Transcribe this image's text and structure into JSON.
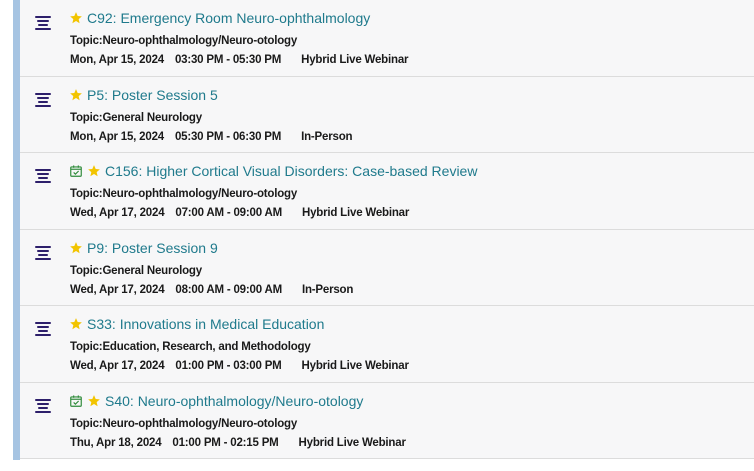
{
  "colors": {
    "accent_bar": "#a6c4e2",
    "title_link": "#1f7a8c",
    "menu_icon": "#2d1f6b",
    "star": "#f2c400",
    "calendar_check": "#2e8b3a"
  },
  "sessions": [
    {
      "title": "C92: Emergency Room Neuro-ophthalmology",
      "topic": "Topic:Neuro-ophthalmology/Neuro-otology",
      "date": "Mon, Apr 15, 2024",
      "time": "03:30 PM - 05:30 PM",
      "format": "Hybrid Live Webinar",
      "icons": [
        "star-icon"
      ]
    },
    {
      "title": "P5: Poster Session 5",
      "topic": "Topic:General Neurology",
      "date": "Mon, Apr 15, 2024",
      "time": "05:30 PM - 06:30 PM",
      "format": "In-Person",
      "icons": [
        "star-icon"
      ]
    },
    {
      "title": "C156: Higher Cortical Visual Disorders: Case-based Review",
      "topic": "Topic:Neuro-ophthalmology/Neuro-otology",
      "date": "Wed, Apr 17, 2024",
      "time": "07:00 AM - 09:00 AM",
      "format": "Hybrid Live Webinar",
      "icons": [
        "calendar-check-icon",
        "star-icon"
      ]
    },
    {
      "title": "P9: Poster Session 9",
      "topic": "Topic:General Neurology",
      "date": "Wed, Apr 17, 2024",
      "time": "08:00 AM - 09:00 AM",
      "format": "In-Person",
      "icons": [
        "star-icon"
      ]
    },
    {
      "title": "S33: Innovations in Medical Education",
      "topic": "Topic:Education, Research, and Methodology",
      "date": "Wed, Apr 17, 2024",
      "time": "01:00 PM - 03:00 PM",
      "format": "Hybrid Live Webinar",
      "icons": [
        "star-icon"
      ]
    },
    {
      "title": "S40: Neuro-ophthalmology/Neuro-otology",
      "topic": "Topic:Neuro-ophthalmology/Neuro-otology",
      "date": "Thu, Apr 18, 2024",
      "time": "01:00 PM - 02:15 PM",
      "format": "Hybrid Live Webinar",
      "icons": [
        "calendar-check-icon",
        "star-icon"
      ]
    }
  ]
}
